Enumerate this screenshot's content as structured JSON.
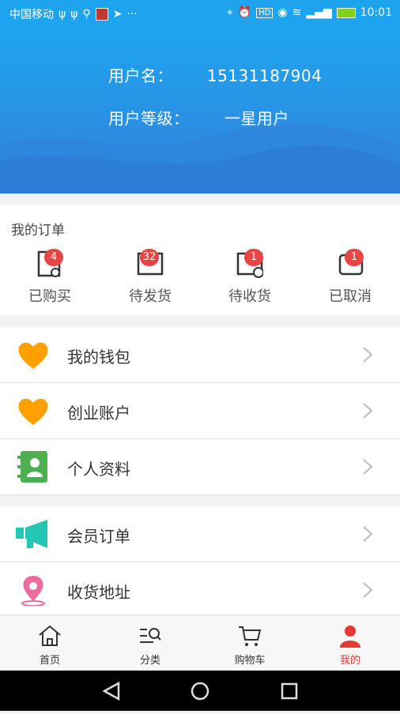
{
  "status_bar": {
    "carrier": "中国移动",
    "time": "10:01",
    "icons": [
      "usb-icon",
      "usb-icon",
      "search-icon",
      "app-icon",
      "telegram-icon",
      "more-icon",
      "location-icon",
      "alarm-icon",
      "hd-icon",
      "eye-icon",
      "wifi-icon",
      "signal-icon",
      "battery-icon"
    ]
  },
  "profile": {
    "username_label": "用户名：",
    "username": "15131187904",
    "level_label": "用户等级：",
    "level": "一星用户"
  },
  "orders": {
    "title": "我的订单",
    "items": [
      {
        "label": "已购买",
        "count": "4"
      },
      {
        "label": "待发货",
        "count": "32"
      },
      {
        "label": "待收货",
        "count": "1"
      },
      {
        "label": "已取消",
        "count": "1"
      }
    ]
  },
  "menu": {
    "group1": [
      {
        "label": "我的钱包",
        "icon": "heart-icon"
      },
      {
        "label": "创业账户",
        "icon": "heart-icon"
      },
      {
        "label": "个人资料",
        "icon": "contact-book-icon"
      }
    ],
    "group2": [
      {
        "label": "会员订单",
        "icon": "megaphone-icon"
      },
      {
        "label": "收货地址",
        "icon": "location-pin-icon"
      }
    ]
  },
  "tabbar": {
    "tabs": [
      {
        "label": "首页",
        "icon": "home-icon"
      },
      {
        "label": "分类",
        "icon": "category-search-icon"
      },
      {
        "label": "购物车",
        "icon": "cart-icon"
      },
      {
        "label": "我的",
        "icon": "user-icon",
        "active": true
      }
    ]
  },
  "colors": {
    "header": "#1ea4ee",
    "badge": "#e84545",
    "active_tab": "#e53935",
    "heart": "#ffa000",
    "contact": "#4caf50",
    "megaphone": "#26c6b6",
    "pin": "#ec6a9d"
  }
}
